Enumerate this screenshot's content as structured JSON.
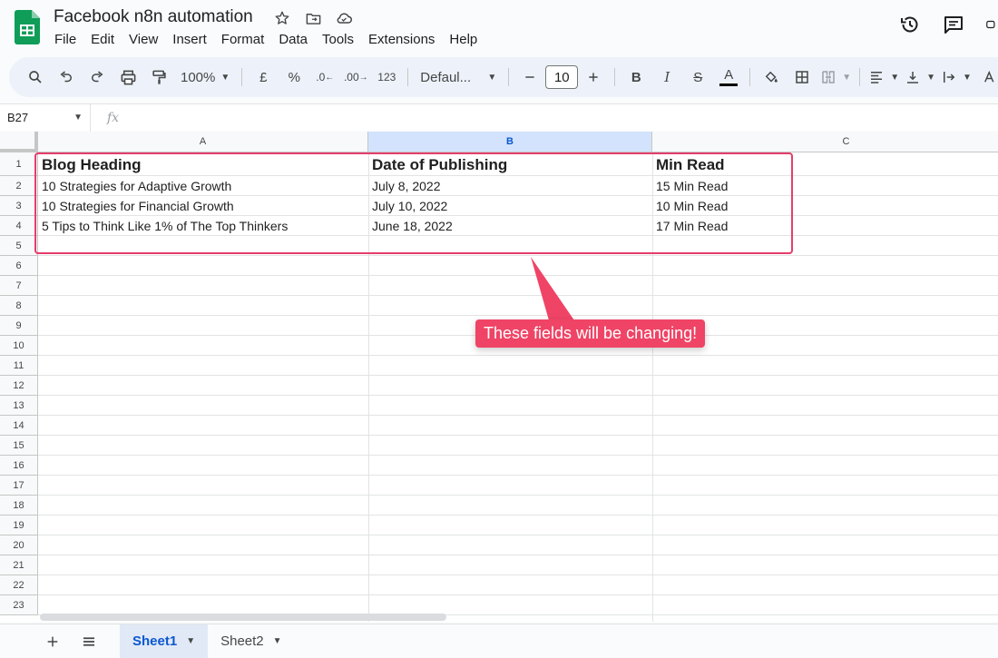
{
  "document": {
    "title": "Facebook n8n automation"
  },
  "menu": [
    "File",
    "Edit",
    "View",
    "Insert",
    "Format",
    "Data",
    "Tools",
    "Extensions",
    "Help"
  ],
  "toolbar": {
    "zoom": "100%",
    "currency": "£",
    "percent": "%",
    "decrease_decimal": ".0",
    "increase_decimal": ".00",
    "number_format": "123",
    "font": "Defaul...",
    "font_size": "10",
    "bold": "B",
    "italic": "I",
    "strike": "S",
    "text_color": "A"
  },
  "formula_bar": {
    "cell_ref": "B27",
    "fx": "fx",
    "value": ""
  },
  "columns": [
    "A",
    "B",
    "C"
  ],
  "selected_column": "B",
  "rows": [
    "1",
    "2",
    "3",
    "4",
    "5",
    "6",
    "7",
    "8",
    "9",
    "10",
    "11",
    "12",
    "13",
    "14",
    "15",
    "16",
    "17",
    "18",
    "19",
    "20",
    "21",
    "22",
    "23"
  ],
  "table": {
    "headers": [
      "Blog Heading",
      "Date of Publishing",
      "Min Read"
    ],
    "data": [
      [
        "10 Strategies for Adaptive Growth",
        "July 8, 2022",
        "15 Min Read"
      ],
      [
        "10 Strategies for Financial Growth",
        "July 10, 2022",
        "10 Min Read"
      ],
      [
        "5 Tips to Think Like 1% of The Top Thinkers",
        "June 18, 2022",
        "17 Min Read"
      ]
    ]
  },
  "annotation": {
    "text": "These fields will be changing!",
    "color": "#ef4466"
  },
  "sheets": [
    {
      "label": "Sheet1",
      "active": true
    },
    {
      "label": "Sheet2",
      "active": false
    }
  ],
  "colors": {
    "accent": "#0b57d0",
    "sheets_green": "#0f9d58",
    "highlight_border": "#e63d6b"
  }
}
